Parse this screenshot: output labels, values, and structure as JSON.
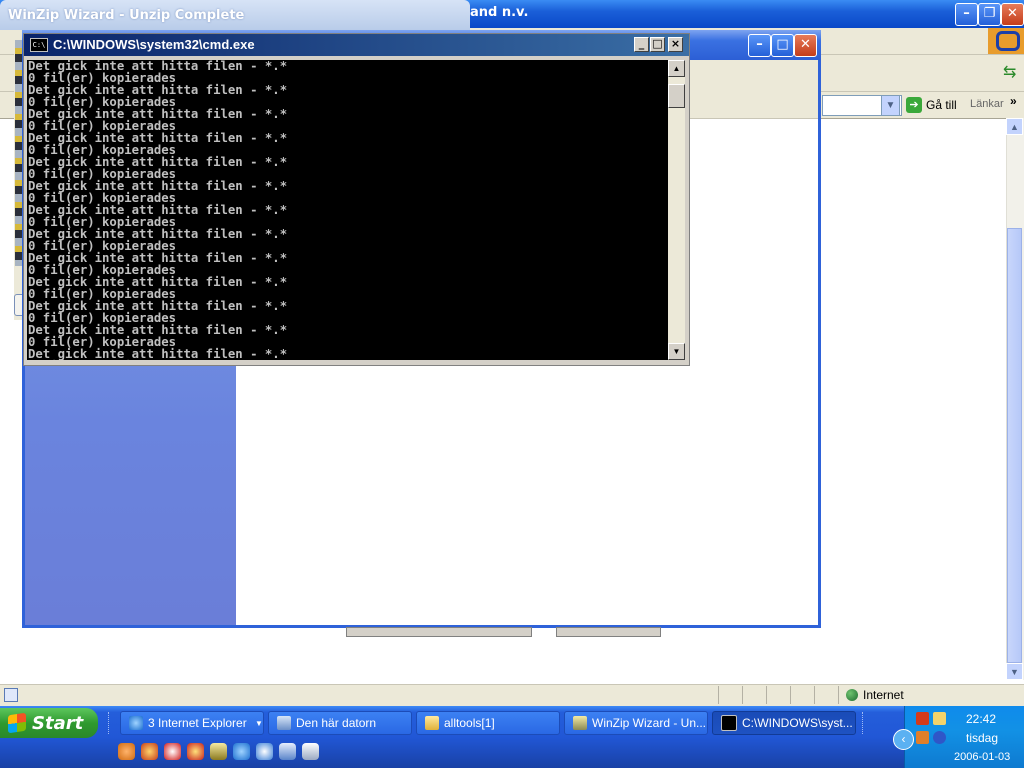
{
  "ie": {
    "title_fragment": "and n.v.",
    "goto_label": "Gå till",
    "links_label": "Länkar",
    "status_zone": "Internet"
  },
  "winzip": {
    "title": "WinZip Wizard - Unzip Complete"
  },
  "cmd": {
    "title": "C:\\WINDOWS\\system32\\cmd.exe",
    "icon_text": "C:\\",
    "lines": [
      "Det gick inte att hitta filen - *.*",
      "0 fil(er) kopierades",
      "Det gick inte att hitta filen - *.*",
      "0 fil(er) kopierades",
      "Det gick inte att hitta filen - *.*",
      "0 fil(er) kopierades",
      "Det gick inte att hitta filen - *.*",
      "0 fil(er) kopierades",
      "Det gick inte att hitta filen - *.*",
      "0 fil(er) kopierades",
      "Det gick inte att hitta filen - *.*",
      "0 fil(er) kopierades",
      "Det gick inte att hitta filen - *.*",
      "0 fil(er) kopierades",
      "Det gick inte att hitta filen - *.*",
      "0 fil(er) kopierades",
      "Det gick inte att hitta filen - *.*",
      "0 fil(er) kopierades",
      "Det gick inte att hitta filen - *.*",
      "0 fil(er) kopierades",
      "Det gick inte att hitta filen - *.*",
      "0 fil(er) kopierades",
      "Det gick inte att hitta filen - *.*",
      "0 fil(er) kopierades",
      "Det gick inte att hitta filen - *.*",
      "0 fil(er) kopierades"
    ]
  },
  "taskbar": {
    "start_label": "Start",
    "tasks": [
      {
        "label": "3 Internet Explorer",
        "icon": "ie-icon"
      },
      {
        "label": "Den här datorn",
        "icon": "computer-icon"
      },
      {
        "label": "alltools[1]",
        "icon": "folder-icon"
      },
      {
        "label": "WinZip Wizard - Un...",
        "icon": "winzip-icon"
      },
      {
        "label": "C:\\WINDOWS\\syst...",
        "icon": "cmd-icon"
      }
    ],
    "clock": {
      "time": "22:42",
      "day": "tisdag",
      "date": "2006-01-03"
    }
  },
  "colors": {
    "xp_blue": "#245edb",
    "cmd_bg": "#000000",
    "cmd_text": "#c0c0c0",
    "tray_blue": "#0f8bec",
    "start_green": "#2f9a2f"
  }
}
